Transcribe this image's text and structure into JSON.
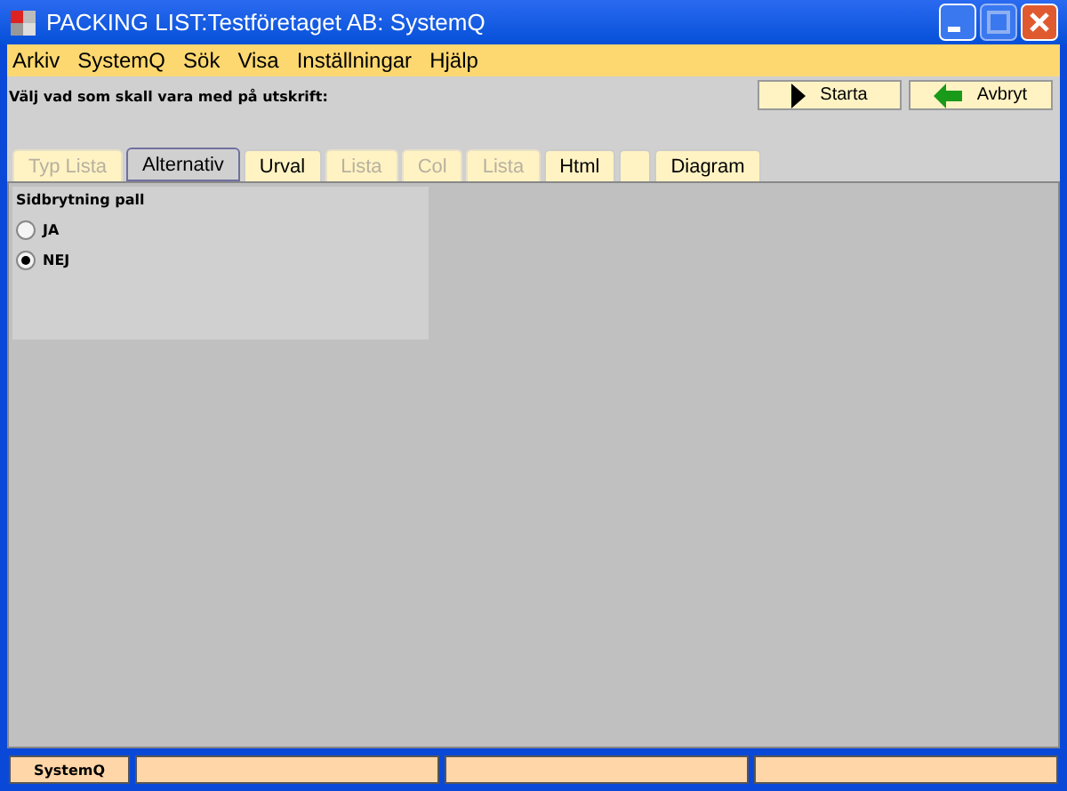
{
  "window": {
    "title": "PACKING LIST:Testföretaget AB: SystemQ"
  },
  "menu": [
    "Arkiv",
    "SystemQ",
    "Sök",
    "Visa",
    "Inställningar",
    "Hjälp"
  ],
  "instruction": "Välj vad som skall vara med på utskrift:",
  "buttons": [
    {
      "label": "Starta",
      "kind": "play"
    },
    {
      "label": "Avbryt",
      "kind": "back"
    }
  ],
  "tabs": [
    {
      "label": "Typ Lista",
      "selected": false,
      "disabled": true
    },
    {
      "label": "Alternativ",
      "selected": true,
      "disabled": false
    },
    {
      "label": "Urval",
      "selected": false,
      "disabled": false
    },
    {
      "label": "Lista",
      "selected": false,
      "disabled": true
    },
    {
      "label": "Col",
      "selected": false,
      "disabled": true
    },
    {
      "label": "Lista",
      "selected": false,
      "disabled": true
    },
    {
      "label": "Html",
      "selected": false,
      "disabled": false
    },
    {
      "selected": false,
      "disabled": false
    },
    {
      "label": "Diagram",
      "selected": false,
      "disabled": false
    }
  ],
  "group": {
    "title": "Sidbrytning pall",
    "options": [
      {
        "label": "JA",
        "selected": false
      },
      {
        "label": "NEJ",
        "selected": true
      }
    ]
  },
  "status_bar": {
    "text": "SystemQ"
  }
}
